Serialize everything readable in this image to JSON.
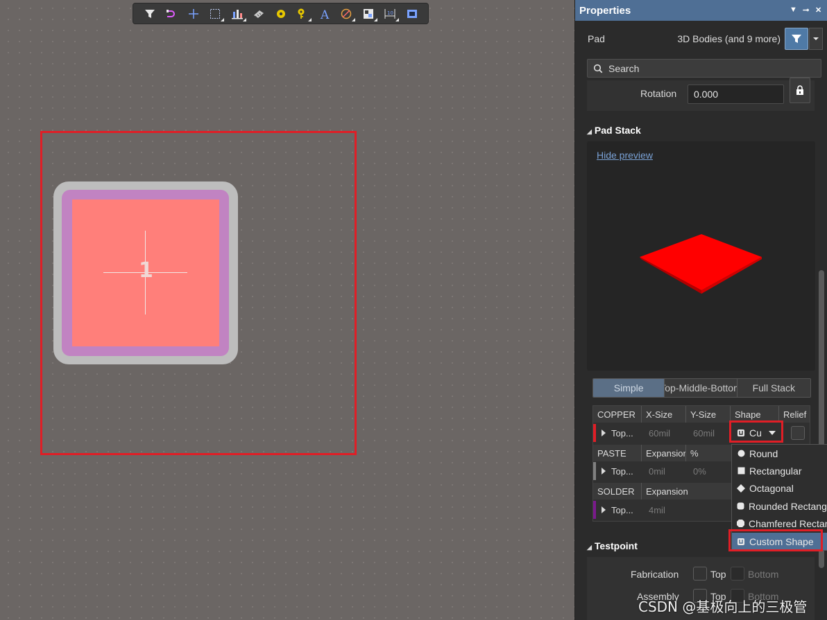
{
  "toolbar": {
    "icons": [
      "filter-icon",
      "route-icon",
      "plus-icon",
      "select-rect-icon",
      "align-icon",
      "component-icon",
      "pad-icon",
      "via-icon",
      "text-icon",
      "arc-icon",
      "polygon-icon",
      "dimension-icon",
      "region-icon"
    ]
  },
  "canvas": {
    "pad_designator": "1"
  },
  "properties": {
    "title": "Properties",
    "object_type": "Pad",
    "filter_summary": "3D Bodies (and 9 more)",
    "search_placeholder": "Search",
    "rotation_label": "Rotation",
    "rotation_value": "0.000"
  },
  "pad_stack": {
    "header": "Pad Stack",
    "hide_preview": "Hide preview",
    "preview_color": "#ff0000",
    "tabs": [
      {
        "label": "Simple",
        "active": true
      },
      {
        "label": "Top-Middle-Bottom",
        "active": false
      },
      {
        "label": "Full Stack",
        "active": false
      }
    ],
    "copper": {
      "headers": [
        "COPPER",
        "X-Size",
        "Y-Size",
        "Shape",
        "Relief"
      ],
      "row": {
        "layer": "Top...",
        "x_size": "60mil",
        "y_size": "60mil",
        "shape": "Cu",
        "color": "#e01e26"
      }
    },
    "paste": {
      "headers": [
        "PASTE",
        "Expansion",
        "%"
      ],
      "row": {
        "layer": "Top...",
        "expansion": "0mil",
        "percent": "0%",
        "color": "#808080"
      }
    },
    "solder": {
      "headers": [
        "SOLDER",
        "Expansion"
      ],
      "row": {
        "layer": "Top...",
        "expansion": "4mil",
        "color": "#7a1a8c"
      }
    },
    "shape_options": [
      "Round",
      "Rectangular",
      "Octagonal",
      "Rounded Rectangle",
      "Chamfered Rectangle",
      "Custom Shape"
    ],
    "selected_shape": "Custom Shape"
  },
  "testpoint": {
    "header": "Testpoint",
    "fabrication_label": "Fabrication",
    "assembly_label": "Assembly",
    "top_label": "Top",
    "bottom_label": "Bottom"
  },
  "watermark": "CSDN @基极向上的三极管"
}
